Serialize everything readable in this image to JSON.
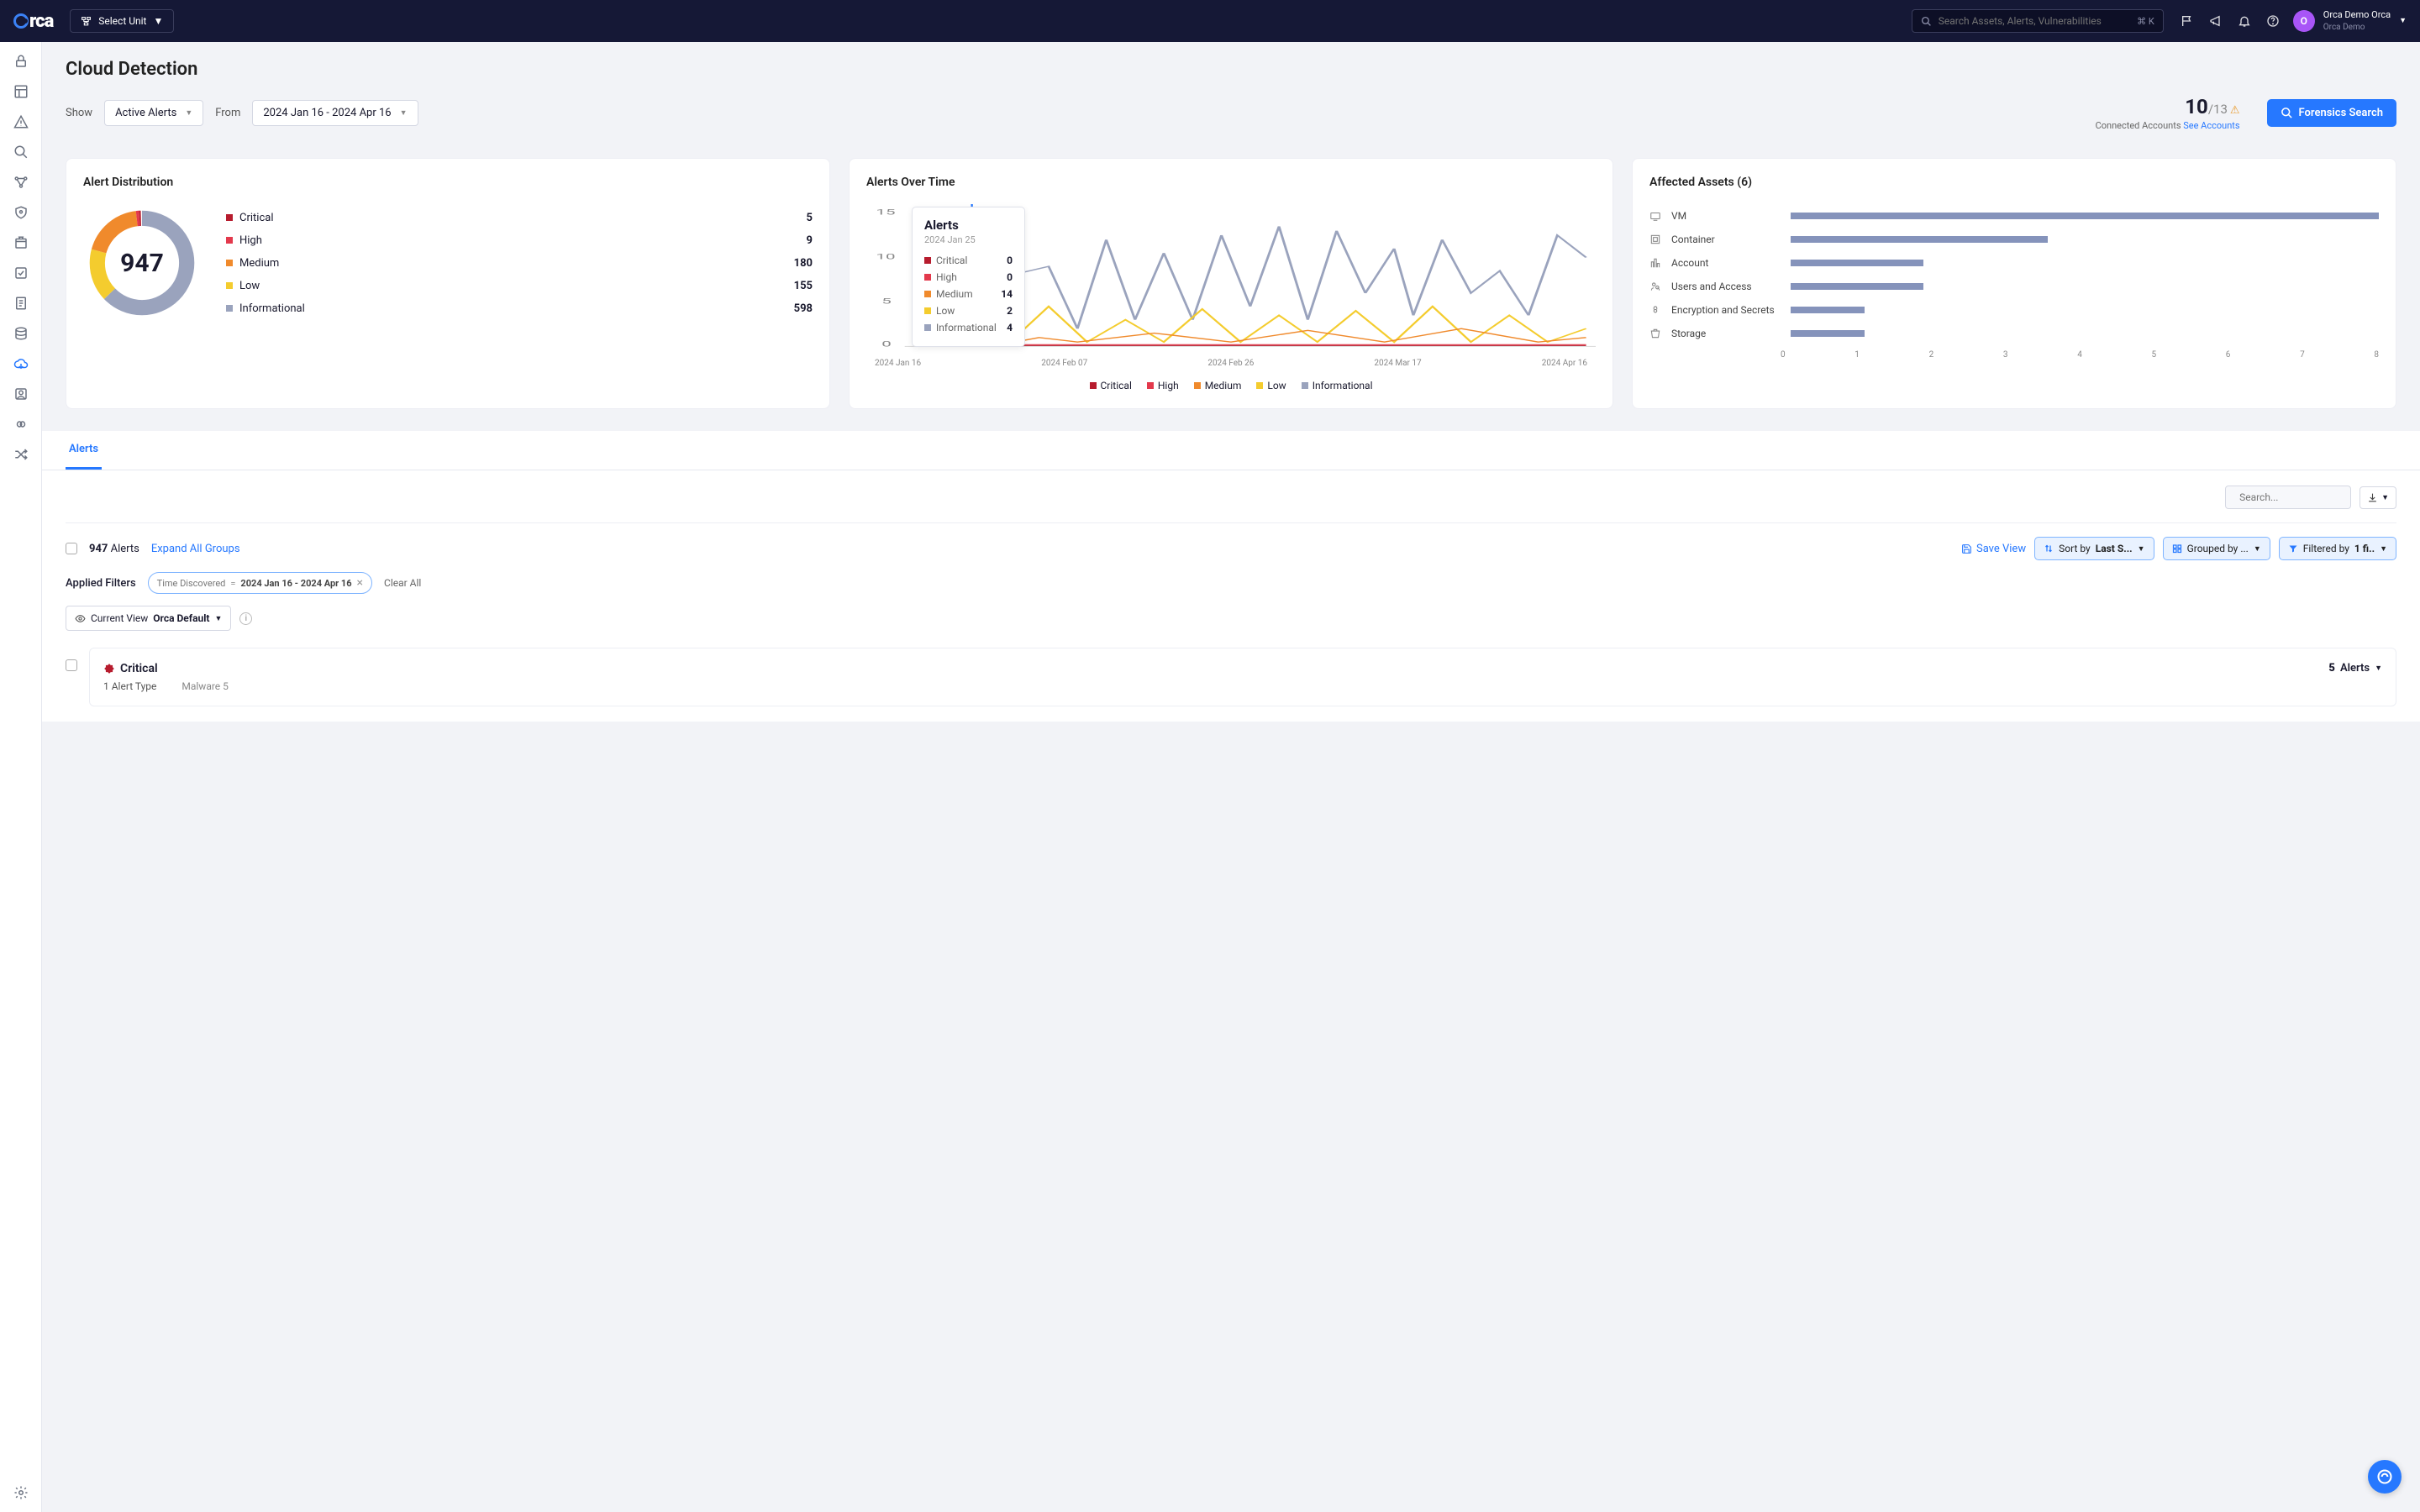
{
  "header": {
    "unit_select_label": "Select Unit",
    "search_placeholder": "Search Assets, Alerts, Vulnerabilities",
    "kbd": "⌘ K",
    "user_name": "Orca Demo Orca",
    "user_org": "Orca Demo",
    "avatar_initial": "O"
  },
  "page": {
    "title": "Cloud Detection",
    "show_label": "Show",
    "show_value": "Active Alerts",
    "from_label": "From",
    "from_value": "2024 Jan 16 - 2024 Apr 16",
    "accounts_connected": "10",
    "accounts_total": "/13",
    "accounts_label": "Connected Accounts ",
    "see_accounts": "See Accounts",
    "forensics_button": "Forensics Search"
  },
  "distribution": {
    "title": "Alert Distribution",
    "total": "947",
    "items": [
      {
        "label": "Critical",
        "value": "5",
        "color": "#b71c2e"
      },
      {
        "label": "High",
        "value": "9",
        "color": "#e3394c"
      },
      {
        "label": "Medium",
        "value": "180",
        "color": "#f08a2c"
      },
      {
        "label": "Low",
        "value": "155",
        "color": "#f4cc2e"
      },
      {
        "label": "Informational",
        "value": "598",
        "color": "#9aa3bd"
      }
    ]
  },
  "chart_data": {
    "type": "line",
    "title": "Alerts Over Time",
    "x_ticks": [
      "2024 Jan 16",
      "2024 Feb 07",
      "2024 Feb 26",
      "2024 Mar 17",
      "2024 Apr 16"
    ],
    "ylim": [
      0,
      15
    ],
    "y_ticks": [
      0,
      5,
      10,
      15
    ],
    "series_names": [
      "Critical",
      "High",
      "Medium",
      "Low",
      "Informational"
    ],
    "series_colors": [
      "#b71c2e",
      "#e3394c",
      "#f08a2c",
      "#f4cc2e",
      "#9aa3bd"
    ],
    "tooltip": {
      "title": "Alerts",
      "date": "2024 Jan 25",
      "rows": [
        {
          "label": "Critical",
          "value": "0",
          "color": "#b71c2e"
        },
        {
          "label": "High",
          "value": "0",
          "color": "#e3394c"
        },
        {
          "label": "Medium",
          "value": "14",
          "color": "#f08a2c"
        },
        {
          "label": "Low",
          "value": "2",
          "color": "#f4cc2e"
        },
        {
          "label": "Informational",
          "value": "4",
          "color": "#9aa3bd"
        }
      ]
    }
  },
  "affected": {
    "title": "Affected Assets (6)",
    "items": [
      {
        "label": "VM",
        "value": 8
      },
      {
        "label": "Container",
        "value": 3.5
      },
      {
        "label": "Account",
        "value": 1.8
      },
      {
        "label": "Users and Access",
        "value": 1.8
      },
      {
        "label": "Encryption and Secrets",
        "value": 1
      },
      {
        "label": "Storage",
        "value": 1
      }
    ],
    "x_ticks": [
      "0",
      "1",
      "2",
      "3",
      "4",
      "5",
      "6",
      "7",
      "8"
    ]
  },
  "tabs": {
    "active": "Alerts"
  },
  "list": {
    "search_placeholder": "Search...",
    "count": "947",
    "count_label": " Alerts",
    "expand": "Expand All Groups",
    "save_view": "Save View",
    "sort_label": "Sort by ",
    "sort_value": "Last S...",
    "group_label": "Grouped by ...",
    "filter_label": "Filtered by ",
    "filter_value": "1 fi..",
    "applied_filters_label": "Applied Filters",
    "filter_chip_field": "Time Discovered",
    "filter_chip_op": "=",
    "filter_chip_val": "2024 Jan 16 - 2024 Apr 16",
    "clear_all": "Clear All",
    "current_view_label": "Current View ",
    "current_view_value": "Orca Default",
    "group": {
      "severity": "Critical",
      "alert_type": "1 Alert Type",
      "malware": "Malware 5",
      "count": "5",
      "count_label": " Alerts"
    }
  }
}
